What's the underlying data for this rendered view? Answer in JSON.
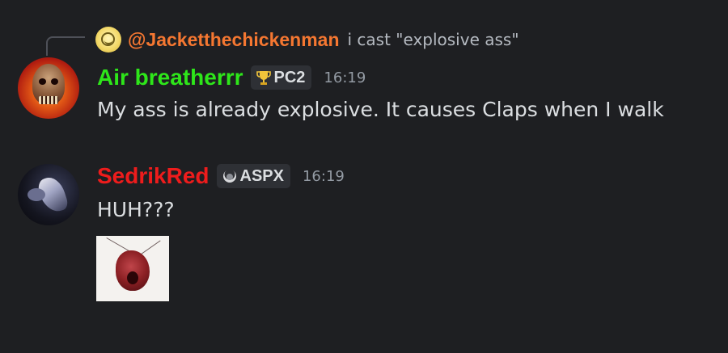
{
  "reply": {
    "username": "@Jacketthechickenman",
    "text": "i cast \"explosive ass\"",
    "avatar_icon": "chick-face-icon",
    "name_color": "#f57731"
  },
  "messages": [
    {
      "username": "Air breatherrr",
      "name_color": "#2ee61a",
      "tag": "PC2",
      "tag_icon": "trophy-icon",
      "timestamp": "16:19",
      "text": "My ass is already explosive. It causes Claps when I walk",
      "avatar_icon": "burning-skull-avatar"
    },
    {
      "username": "SedrikRed",
      "name_color": "#ee1c1c",
      "tag": "ASPX",
      "tag_icon": "crescent-badge-icon",
      "timestamp": "16:19",
      "text": "HUH???",
      "avatar_icon": "dark-creature-avatar",
      "attachment": "red-creature-image"
    }
  ],
  "colors": {
    "background": "#1e1f22",
    "text": "#dbdee1",
    "muted": "#949ba4",
    "tag_bg": "#2e3035"
  }
}
